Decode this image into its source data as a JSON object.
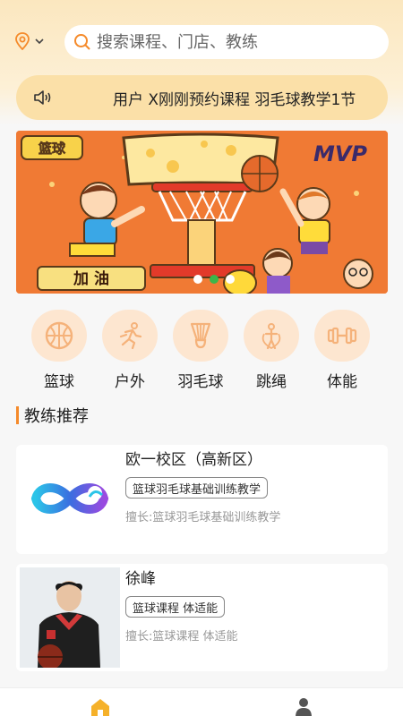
{
  "search": {
    "placeholder": "搜索课程、门店、教练"
  },
  "notice": {
    "text": "用户 X刚刚预约课程 羽毛球教学1节"
  },
  "banner": {
    "texts": [
      "篮球",
      "MVP",
      "加 油"
    ],
    "dots": 3,
    "active_dot": 1
  },
  "categories": [
    {
      "label": "篮球",
      "icon": "basketball-icon"
    },
    {
      "label": "户外",
      "icon": "runner-icon"
    },
    {
      "label": "羽毛球",
      "icon": "shuttlecock-icon"
    },
    {
      "label": "跳绳",
      "icon": "jump-rope-icon"
    },
    {
      "label": "体能",
      "icon": "dumbbell-icon"
    }
  ],
  "section": {
    "title": "教练推荐"
  },
  "coaches": [
    {
      "name": "欧一校区（高新区）",
      "tag": "篮球羽毛球基础训练教学",
      "desc": "擅长:篮球羽毛球基础训练教学",
      "thumb": "infinity-logo"
    },
    {
      "name": "徐峰",
      "tag": "篮球课程 体适能",
      "desc": "擅长:篮球课程 体适能",
      "thumb": "coach-photo"
    }
  ],
  "tabbar": {
    "items": [
      {
        "icon": "home-icon",
        "active": true
      },
      {
        "icon": "user-icon",
        "active": false
      }
    ]
  },
  "colors": {
    "accent": "#f58a2a",
    "banner_bg": "#f07a34",
    "notice_bg": "#fbe0a8"
  }
}
